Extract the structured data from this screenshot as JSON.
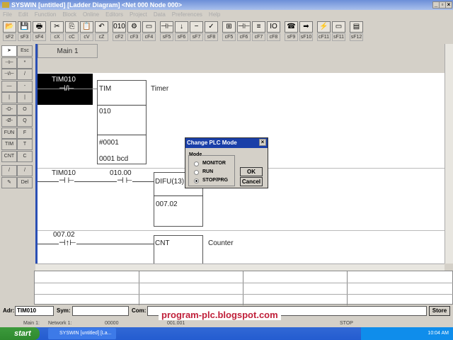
{
  "window": {
    "title": "SYSWIN [untitled] [Ladder Diagram] <Net 000 Node 000>",
    "min": "_",
    "max": "▫",
    "close": "×"
  },
  "menu": [
    "File",
    "Edit",
    "Function",
    "Block",
    "Online",
    "Editors",
    "Project",
    "Data",
    "Preferences",
    "Help"
  ],
  "toolbar": [
    {
      "icon": "open-folder-icon",
      "glyph": "📂",
      "key": "sF2"
    },
    {
      "icon": "save-icon",
      "glyph": "💾",
      "key": "sF3"
    },
    {
      "icon": "print-icon",
      "glyph": "🖶",
      "key": "sF4"
    },
    {
      "icon": "cut-icon",
      "glyph": "✂",
      "key": "cX"
    },
    {
      "icon": "copy-icon",
      "glyph": "⎘",
      "key": "cC"
    },
    {
      "icon": "paste-icon",
      "glyph": "📋",
      "key": "cV"
    },
    {
      "icon": "undo-icon",
      "glyph": "↶",
      "key": "cZ"
    },
    {
      "icon": "address-icon",
      "glyph": "010",
      "key": "cF2"
    },
    {
      "icon": "symbol-icon",
      "glyph": "⚙",
      "key": "cF3"
    },
    {
      "icon": "windows-icon",
      "glyph": "▭",
      "key": "cF4"
    },
    {
      "icon": "insert-rung-icon",
      "glyph": "⊣⊢",
      "key": "sF5"
    },
    {
      "icon": "add-rung-icon",
      "glyph": "↓",
      "key": "sF6"
    },
    {
      "icon": "delete-rung-icon",
      "glyph": "−",
      "key": "sF7"
    },
    {
      "icon": "check-rung-icon",
      "glyph": "✓",
      "key": "sF8"
    },
    {
      "icon": "network-icon",
      "glyph": "⊞",
      "key": "cF5"
    },
    {
      "icon": "ladder-icon",
      "glyph": "⊣⊢",
      "key": "cF6"
    },
    {
      "icon": "mnemonic-icon",
      "glyph": "≡",
      "key": "cF7"
    },
    {
      "icon": "io-icon",
      "glyph": "IO",
      "key": "cF8"
    },
    {
      "icon": "phone-icon",
      "glyph": "☎",
      "key": "sF9"
    },
    {
      "icon": "plc-icon",
      "glyph": "➡",
      "key": "sF10"
    },
    {
      "icon": "online-edit-icon",
      "glyph": "⚡",
      "key": "cF11"
    },
    {
      "icon": "disabled-icon",
      "glyph": "▭",
      "key": "sF11"
    },
    {
      "icon": "monitor-icon",
      "glyph": "▤",
      "key": "sF12"
    }
  ],
  "palette": [
    {
      "icon": "arrow-icon",
      "glyph": "➤",
      "key": "Esc"
    },
    {
      "icon": "no-contact-icon",
      "glyph": "⊣⊢",
      "key": "*"
    },
    {
      "icon": "nc-contact-icon",
      "glyph": "⊣/⊢",
      "key": "/"
    },
    {
      "icon": "horizontal-line-icon",
      "glyph": "—",
      "key": "-"
    },
    {
      "icon": "vertical-line-icon",
      "glyph": "|",
      "key": "|"
    },
    {
      "icon": "coil-icon",
      "glyph": "-O-",
      "key": "O"
    },
    {
      "icon": "nc-coil-icon",
      "glyph": "-Ø-",
      "key": "Q"
    },
    {
      "icon": "fun-icon",
      "glyph": "FUN",
      "key": "F"
    },
    {
      "icon": "tim-icon",
      "glyph": "TIM",
      "key": "T"
    },
    {
      "icon": "cnt-icon",
      "glyph": "CNT",
      "key": "C"
    },
    {
      "icon": "diagonal-line-icon",
      "glyph": "/",
      "key": "/"
    },
    {
      "icon": "erase-icon",
      "glyph": "✎",
      "key": "Del"
    }
  ],
  "ladder": {
    "tab": "Main 1",
    "rung1": {
      "contact": "TIM010",
      "box": [
        "TIM",
        "010",
        "#0001",
        "0001 bcd"
      ],
      "comment": "Timer"
    },
    "rung2": {
      "contact1": "TIM010",
      "contact2": "010.00",
      "box": [
        "DIFU(13)",
        "007.02"
      ]
    },
    "rung3": {
      "contact": "007.02",
      "box": [
        "CNT"
      ],
      "comment": "Counter"
    }
  },
  "inputs": {
    "adr_label": "Adr:",
    "adr": "TIM010",
    "sym_label": "Sym:",
    "sym": "",
    "com_label": "Com:",
    "com": "",
    "store": "Store"
  },
  "status": [
    "Main 1:",
    "Network 1:",
    "00000",
    "001.001",
    "STOP"
  ],
  "watermark": "program-plc.blogspot.com",
  "taskbar": {
    "start": "start",
    "task": "SYSWIN [untitled] [La...",
    "time": "10:04 AM"
  },
  "dialog": {
    "title": "Change PLC Mode",
    "close": "×",
    "group": "Mode",
    "options": [
      "MONITOR",
      "RUN",
      "STOP/PRG"
    ],
    "selected": "STOP/PRG",
    "ok": "OK",
    "cancel": "Cancel"
  }
}
